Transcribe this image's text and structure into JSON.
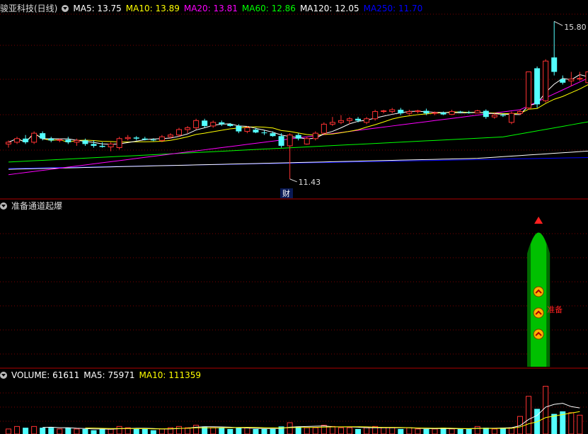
{
  "main_panel": {
    "stock_title": "骏亚科技(日线)",
    "ma_readouts": [
      {
        "label": "MA5: 13.75",
        "color": "#ffffff"
      },
      {
        "label": "MA10: 13.89",
        "color": "#ffff00"
      },
      {
        "label": "MA20: 13.81",
        "color": "#ff00ff"
      },
      {
        "label": "MA60: 12.86",
        "color": "#00ff00"
      },
      {
        "label": "MA120: 12.05",
        "color": "#ffffff"
      },
      {
        "label": "MA250: 11.70",
        "color": "#0000ff"
      }
    ],
    "high_marker": "15.80",
    "low_marker": "11.43",
    "fin_badge": "财"
  },
  "indicator_panel": {
    "title": "准备通道起爆",
    "signal_label": "准备"
  },
  "volume_panel": {
    "readouts": [
      {
        "label": "VOLUME: 61611",
        "color": "#ffffff"
      },
      {
        "label": "MA5: 75971",
        "color": "#ffffff"
      },
      {
        "label": "MA10: 111359",
        "color": "#ffff00"
      }
    ]
  },
  "colors": {
    "up": "#ff3232",
    "down": "#54ffff",
    "grid": "#7a0000",
    "ma5": "#ffffff",
    "ma10": "#ffff00",
    "ma20": "#ff00ff",
    "ma60": "#00ff00",
    "ma120": "#ffffff",
    "ma250": "#0000ff"
  },
  "chart_data": {
    "type": "candlestick",
    "candles": [
      {
        "o": 12.4,
        "h": 12.5,
        "l": 12.3,
        "c": 12.45
      },
      {
        "o": 12.45,
        "h": 12.6,
        "l": 12.4,
        "c": 12.55
      },
      {
        "o": 12.55,
        "h": 12.65,
        "l": 12.4,
        "c": 12.45
      },
      {
        "o": 12.45,
        "h": 12.75,
        "l": 12.4,
        "c": 12.7
      },
      {
        "o": 12.7,
        "h": 12.75,
        "l": 12.5,
        "c": 12.55
      },
      {
        "o": 12.55,
        "h": 12.6,
        "l": 12.45,
        "c": 12.5
      },
      {
        "o": 12.5,
        "h": 12.55,
        "l": 12.45,
        "c": 12.52
      },
      {
        "o": 12.52,
        "h": 12.6,
        "l": 12.4,
        "c": 12.45
      },
      {
        "o": 12.45,
        "h": 12.55,
        "l": 12.35,
        "c": 12.5
      },
      {
        "o": 12.5,
        "h": 12.55,
        "l": 12.35,
        "c": 12.4
      },
      {
        "o": 12.4,
        "h": 12.5,
        "l": 12.3,
        "c": 12.35
      },
      {
        "o": 12.35,
        "h": 12.45,
        "l": 12.3,
        "c": 12.32
      },
      {
        "o": 12.32,
        "h": 12.45,
        "l": 12.2,
        "c": 12.4
      },
      {
        "o": 12.3,
        "h": 12.6,
        "l": 12.25,
        "c": 12.55
      },
      {
        "o": 12.55,
        "h": 12.65,
        "l": 12.5,
        "c": 12.58
      },
      {
        "o": 12.58,
        "h": 12.62,
        "l": 12.5,
        "c": 12.55
      },
      {
        "o": 12.55,
        "h": 12.6,
        "l": 12.5,
        "c": 12.52
      },
      {
        "o": 12.52,
        "h": 12.56,
        "l": 12.48,
        "c": 12.5
      },
      {
        "o": 12.5,
        "h": 12.65,
        "l": 12.45,
        "c": 12.6
      },
      {
        "o": 12.6,
        "h": 12.7,
        "l": 12.55,
        "c": 12.65
      },
      {
        "o": 12.65,
        "h": 12.85,
        "l": 12.6,
        "c": 12.8
      },
      {
        "o": 12.8,
        "h": 12.9,
        "l": 12.7,
        "c": 12.85
      },
      {
        "o": 12.85,
        "h": 13.1,
        "l": 12.8,
        "c": 13.05
      },
      {
        "o": 13.05,
        "h": 13.1,
        "l": 12.85,
        "c": 12.9
      },
      {
        "o": 12.9,
        "h": 13.05,
        "l": 12.85,
        "c": 13.0
      },
      {
        "o": 13.0,
        "h": 13.05,
        "l": 12.9,
        "c": 12.95
      },
      {
        "o": 12.95,
        "h": 12.98,
        "l": 12.88,
        "c": 12.9
      },
      {
        "o": 12.9,
        "h": 12.95,
        "l": 12.7,
        "c": 12.75
      },
      {
        "o": 12.75,
        "h": 12.9,
        "l": 12.7,
        "c": 12.85
      },
      {
        "o": 12.8,
        "h": 12.85,
        "l": 12.7,
        "c": 12.72
      },
      {
        "o": 12.72,
        "h": 12.78,
        "l": 12.65,
        "c": 12.7
      },
      {
        "o": 12.7,
        "h": 12.75,
        "l": 12.6,
        "c": 12.62
      },
      {
        "o": 12.62,
        "h": 12.7,
        "l": 12.3,
        "c": 12.35
      },
      {
        "o": 12.35,
        "h": 12.7,
        "l": 11.43,
        "c": 12.65
      },
      {
        "o": 12.65,
        "h": 12.7,
        "l": 12.5,
        "c": 12.55
      },
      {
        "o": 12.4,
        "h": 12.6,
        "l": 12.38,
        "c": 12.55
      },
      {
        "o": 12.55,
        "h": 12.75,
        "l": 12.5,
        "c": 12.7
      },
      {
        "o": 12.7,
        "h": 13.0,
        "l": 12.65,
        "c": 12.95
      },
      {
        "o": 12.95,
        "h": 13.15,
        "l": 12.9,
        "c": 13.0
      },
      {
        "o": 13.0,
        "h": 13.2,
        "l": 12.95,
        "c": 13.05
      },
      {
        "o": 13.05,
        "h": 13.15,
        "l": 12.95,
        "c": 13.1
      },
      {
        "o": 13.1,
        "h": 13.15,
        "l": 13.0,
        "c": 13.05
      },
      {
        "o": 13.0,
        "h": 13.15,
        "l": 12.95,
        "c": 13.1
      },
      {
        "o": 13.1,
        "h": 13.35,
        "l": 13.05,
        "c": 13.3
      },
      {
        "o": 13.3,
        "h": 13.35,
        "l": 13.25,
        "c": 13.32
      },
      {
        "o": 13.3,
        "h": 13.4,
        "l": 13.25,
        "c": 13.35
      },
      {
        "o": 13.35,
        "h": 13.4,
        "l": 13.2,
        "c": 13.25
      },
      {
        "o": 13.25,
        "h": 13.35,
        "l": 13.2,
        "c": 13.3
      },
      {
        "o": 13.3,
        "h": 13.35,
        "l": 13.25,
        "c": 13.32
      },
      {
        "o": 13.32,
        "h": 13.38,
        "l": 13.2,
        "c": 13.25
      },
      {
        "o": 13.25,
        "h": 13.3,
        "l": 13.2,
        "c": 13.27
      },
      {
        "o": 13.27,
        "h": 13.3,
        "l": 13.2,
        "c": 13.22
      },
      {
        "o": 13.22,
        "h": 13.35,
        "l": 13.2,
        "c": 13.3
      },
      {
        "o": 13.3,
        "h": 13.32,
        "l": 13.25,
        "c": 13.28
      },
      {
        "o": 13.28,
        "h": 13.32,
        "l": 13.24,
        "c": 13.26
      },
      {
        "o": 13.26,
        "h": 13.35,
        "l": 13.25,
        "c": 13.32
      },
      {
        "o": 13.32,
        "h": 13.36,
        "l": 13.1,
        "c": 13.15
      },
      {
        "o": 13.15,
        "h": 13.25,
        "l": 13.1,
        "c": 13.2
      },
      {
        "o": 13.2,
        "h": 13.25,
        "l": 13.15,
        "c": 13.18
      },
      {
        "o": 13.0,
        "h": 13.3,
        "l": 12.95,
        "c": 13.25
      },
      {
        "o": 13.25,
        "h": 13.35,
        "l": 13.2,
        "c": 13.3
      },
      {
        "o": 13.4,
        "h": 14.4,
        "l": 13.35,
        "c": 14.4
      },
      {
        "o": 14.5,
        "h": 14.55,
        "l": 13.4,
        "c": 13.5
      },
      {
        "o": 13.6,
        "h": 14.75,
        "l": 13.55,
        "c": 14.7
      },
      {
        "o": 14.8,
        "h": 15.8,
        "l": 14.3,
        "c": 14.4
      },
      {
        "o": 14.2,
        "h": 14.3,
        "l": 14.05,
        "c": 14.1
      },
      {
        "o": 14.15,
        "h": 14.4,
        "l": 14.0,
        "c": 14.2
      },
      {
        "o": 14.2,
        "h": 14.4,
        "l": 14.15,
        "c": 14.22
      },
      {
        "o": 14.1,
        "h": 14.45,
        "l": 14.05,
        "c": 14.4
      }
    ],
    "volume": [
      4,
      6,
      5,
      6,
      5,
      5,
      4,
      5,
      4,
      4,
      3,
      4,
      4,
      6,
      5,
      4,
      4,
      3,
      4,
      5,
      6,
      5,
      7,
      6,
      5,
      5,
      4,
      5,
      5,
      4,
      4,
      4,
      6,
      9,
      6,
      5,
      5,
      7,
      6,
      5,
      5,
      4,
      5,
      6,
      5,
      5,
      4,
      5,
      4,
      4,
      4,
      5,
      4,
      4,
      4,
      6,
      5,
      4,
      5,
      5,
      14,
      30,
      20,
      38,
      16,
      18,
      17,
      15
    ],
    "volume_max": 40,
    "indicator": {
      "channel_start_index": 61,
      "channel_end_index": 63,
      "signal_levels": [
        0.25,
        0.5,
        0.75
      ]
    },
    "ylim": [
      11.25,
      16.0
    ]
  }
}
